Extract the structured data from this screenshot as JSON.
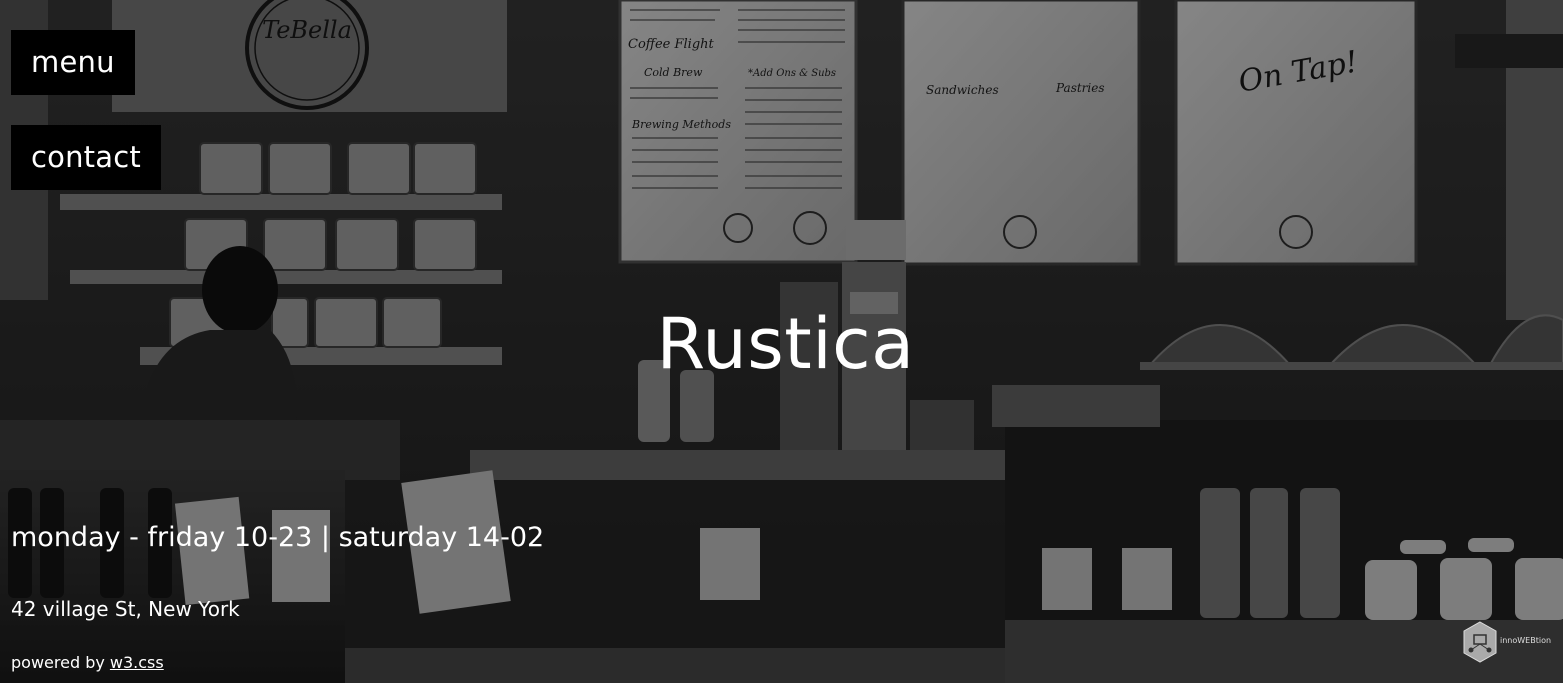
{
  "nav": {
    "menu_label": "menu",
    "contact_label": "contact"
  },
  "hero": {
    "title": "Rustica",
    "hours": "monday - friday 10-23 | saturday 14-02",
    "address": "42 village St, New York",
    "powered_prefix": "powered by ",
    "powered_link": "w3.css"
  },
  "badge": {
    "text": "innoWEBtion",
    "icon": "hexagon-network-icon"
  },
  "background": {
    "signs": {
      "logo": "TeBella",
      "coffee_flight": "Coffee Flight",
      "cold_brew": "Cold Brew",
      "brewing_methods": "Brewing Methods",
      "add_ons": "*Add Ons & Subs",
      "sandwiches": "Sandwiches",
      "pastries": "Pastries",
      "on_tap": "On Tap!"
    },
    "colors": {
      "overlay": "#000000",
      "chalkboard": "#dedede",
      "shelf": "#8a8a8a"
    }
  }
}
